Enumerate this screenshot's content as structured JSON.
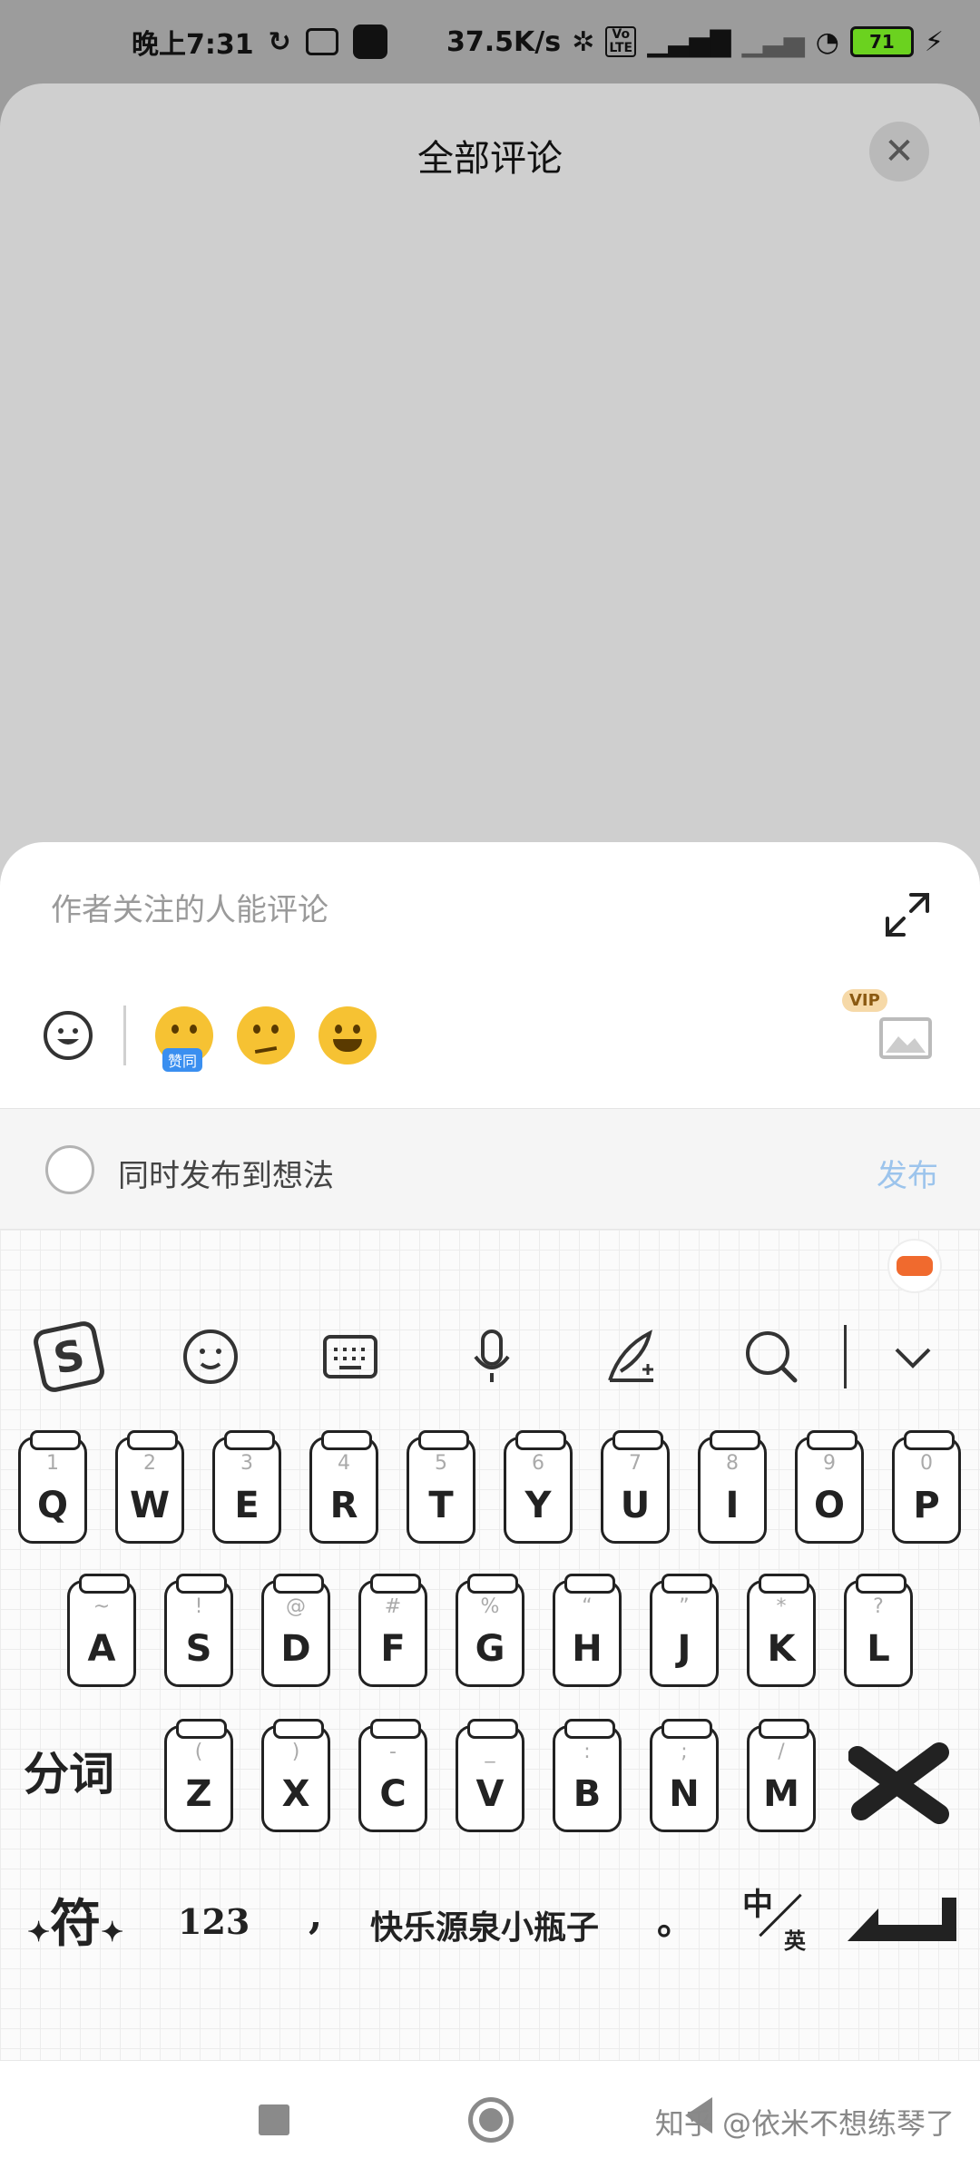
{
  "status_bar": {
    "time": "晚上7:31",
    "network_speed": "37.5K/s",
    "battery_level": "71",
    "volte_label": "Vo LTE"
  },
  "comments": {
    "title": "全部评论",
    "close_icon": "close-icon"
  },
  "composer": {
    "placeholder": "作者关注的人能评论",
    "emoji_badge": "赞同",
    "vip_label": "VIP",
    "sync_label": "同时发布到想法",
    "publish_label": "发布"
  },
  "keyboard": {
    "row1": [
      {
        "letter": "Q",
        "hint": "1"
      },
      {
        "letter": "W",
        "hint": "2"
      },
      {
        "letter": "E",
        "hint": "3"
      },
      {
        "letter": "R",
        "hint": "4"
      },
      {
        "letter": "T",
        "hint": "5"
      },
      {
        "letter": "Y",
        "hint": "6"
      },
      {
        "letter": "U",
        "hint": "7"
      },
      {
        "letter": "I",
        "hint": "8"
      },
      {
        "letter": "O",
        "hint": "9"
      },
      {
        "letter": "P",
        "hint": "0"
      }
    ],
    "row2": [
      {
        "letter": "A",
        "hint": "~"
      },
      {
        "letter": "S",
        "hint": "!"
      },
      {
        "letter": "D",
        "hint": "@"
      },
      {
        "letter": "F",
        "hint": "#"
      },
      {
        "letter": "G",
        "hint": "%"
      },
      {
        "letter": "H",
        "hint": "“"
      },
      {
        "letter": "J",
        "hint": "”"
      },
      {
        "letter": "K",
        "hint": "*"
      },
      {
        "letter": "L",
        "hint": "?"
      }
    ],
    "row3": [
      {
        "letter": "Z",
        "hint": "("
      },
      {
        "letter": "X",
        "hint": ")"
      },
      {
        "letter": "C",
        "hint": "-"
      },
      {
        "letter": "V",
        "hint": "_"
      },
      {
        "letter": "B",
        "hint": ":"
      },
      {
        "letter": "N",
        "hint": ";"
      },
      {
        "letter": "M",
        "hint": "/"
      }
    ],
    "segment_label": "分词",
    "symbol_label": "符",
    "numbers_label": "123",
    "comma_label": ",",
    "space_label": "快乐源泉小瓶子",
    "period_label": "。",
    "lang_zh": "中",
    "lang_en": "英"
  },
  "watermark": "知乎 @依米不想练琴了"
}
